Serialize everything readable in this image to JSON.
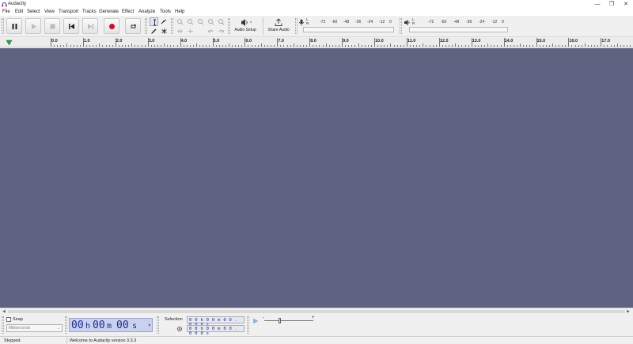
{
  "window": {
    "title": "Audacity",
    "minimize": "—",
    "maximize": "❐",
    "close": "✕"
  },
  "menu": [
    "File",
    "Edit",
    "Select",
    "View",
    "Transport",
    "Tracks",
    "Generate",
    "Effect",
    "Analyze",
    "Tools",
    "Help"
  ],
  "toolbar": {
    "audio_setup_label": "Audio Setup",
    "share_audio_label": "Share Audio",
    "record_meter": {
      "channels": [
        "L",
        "R"
      ],
      "scale": [
        "-72",
        "-60",
        "-48",
        "-36",
        "-24",
        "-12",
        "0"
      ]
    },
    "play_meter": {
      "channels": [
        "L",
        "R"
      ],
      "scale": [
        "-72",
        "-60",
        "-48",
        "-36",
        "-24",
        "-12",
        "0"
      ]
    },
    "colors": {
      "record": "#c8102e",
      "play_disabled": "#b8bcc8",
      "icon": "#333333"
    }
  },
  "ruler": {
    "labels": [
      "0.0",
      "1.0",
      "2.0",
      "3.0",
      "4.0",
      "5.0",
      "6.0",
      "7.0",
      "8.0",
      "9.0",
      "10.0",
      "11.0",
      "12.0",
      "13.0",
      "14.0",
      "15.0",
      "16.0",
      "17.0",
      "18.0"
    ]
  },
  "track_area": {
    "background": "#5f6180"
  },
  "bottom": {
    "snap_label": "Snap",
    "snap_unit": "Milliseconds",
    "time": {
      "hours": "00",
      "h": "h",
      "minutes": "00",
      "m": "m",
      "seconds": "00",
      "s": "s"
    },
    "selection_label": "Selection",
    "selection_start": "0 0 h 0 0 m 0 0 . 0 0 0 s",
    "selection_end": "0 0 h 0 0 m 0 0 . 0 0 0 s",
    "play_at_speed_min": "-",
    "play_at_speed_max": "+"
  },
  "status": {
    "state": "Stopped.",
    "message": "Welcome to Audacity version 3.3.3"
  }
}
